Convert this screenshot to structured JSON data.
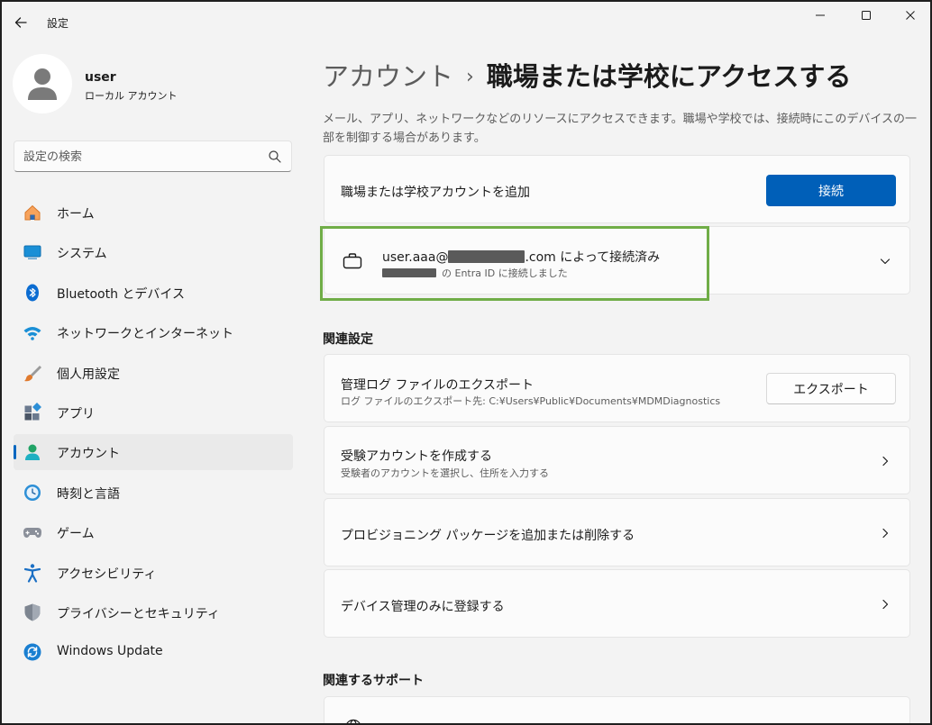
{
  "app": {
    "title": "設定"
  },
  "profile": {
    "name": "user",
    "account_type": "ローカル アカウント"
  },
  "search": {
    "placeholder": "設定の検索"
  },
  "nav": {
    "items": [
      {
        "label": "ホーム",
        "icon": "home-icon"
      },
      {
        "label": "システム",
        "icon": "system-icon"
      },
      {
        "label": "Bluetooth とデバイス",
        "icon": "bluetooth-icon"
      },
      {
        "label": "ネットワークとインターネット",
        "icon": "wifi-icon"
      },
      {
        "label": "個人用設定",
        "icon": "brush-icon"
      },
      {
        "label": "アプリ",
        "icon": "apps-icon"
      },
      {
        "label": "アカウント",
        "icon": "account-icon"
      },
      {
        "label": "時刻と言語",
        "icon": "clock-globe-icon"
      },
      {
        "label": "ゲーム",
        "icon": "gamepad-icon"
      },
      {
        "label": "アクセシビリティ",
        "icon": "accessibility-icon"
      },
      {
        "label": "プライバシーとセキュリティ",
        "icon": "shield-icon"
      },
      {
        "label": "Windows Update",
        "icon": "update-icon"
      }
    ],
    "active_index": 6
  },
  "header": {
    "breadcrumb_parent": "アカウント",
    "breadcrumb_separator": "›",
    "title": "職場または学校にアクセスする"
  },
  "description": "メール、アプリ、ネットワークなどのリソースにアクセスできます。職場や学校では、接続時にこのデバイスの一部を制御する場合があります。",
  "add_account": {
    "label": "職場または学校アカウントを追加",
    "button": "接続"
  },
  "connected_account": {
    "email_prefix": "user.aaa@",
    "email_suffix": ".com によって接続済み",
    "subtitle_suffix": "の Entra ID に接続しました"
  },
  "related_settings": {
    "heading": "関連設定",
    "export": {
      "title": "管理ログ ファイルのエクスポート",
      "subtitle": "ログ ファイルのエクスポート先: C:¥Users¥Public¥Documents¥MDMDiagnostics",
      "button": "エクスポート"
    },
    "exam": {
      "title": "受験アカウントを作成する",
      "subtitle": "受験者のアカウントを選択し、住所を入力する"
    },
    "provisioning": {
      "title": "プロビジョニング パッケージを追加または削除する"
    },
    "device_mgmt": {
      "title": "デバイス管理のみに登録する"
    }
  },
  "related_support": {
    "heading": "関連するサポート"
  },
  "colors": {
    "accent": "#005fb8",
    "highlight": "#70ad47",
    "background": "#f3f3f3",
    "card": "#fbfbfb"
  }
}
